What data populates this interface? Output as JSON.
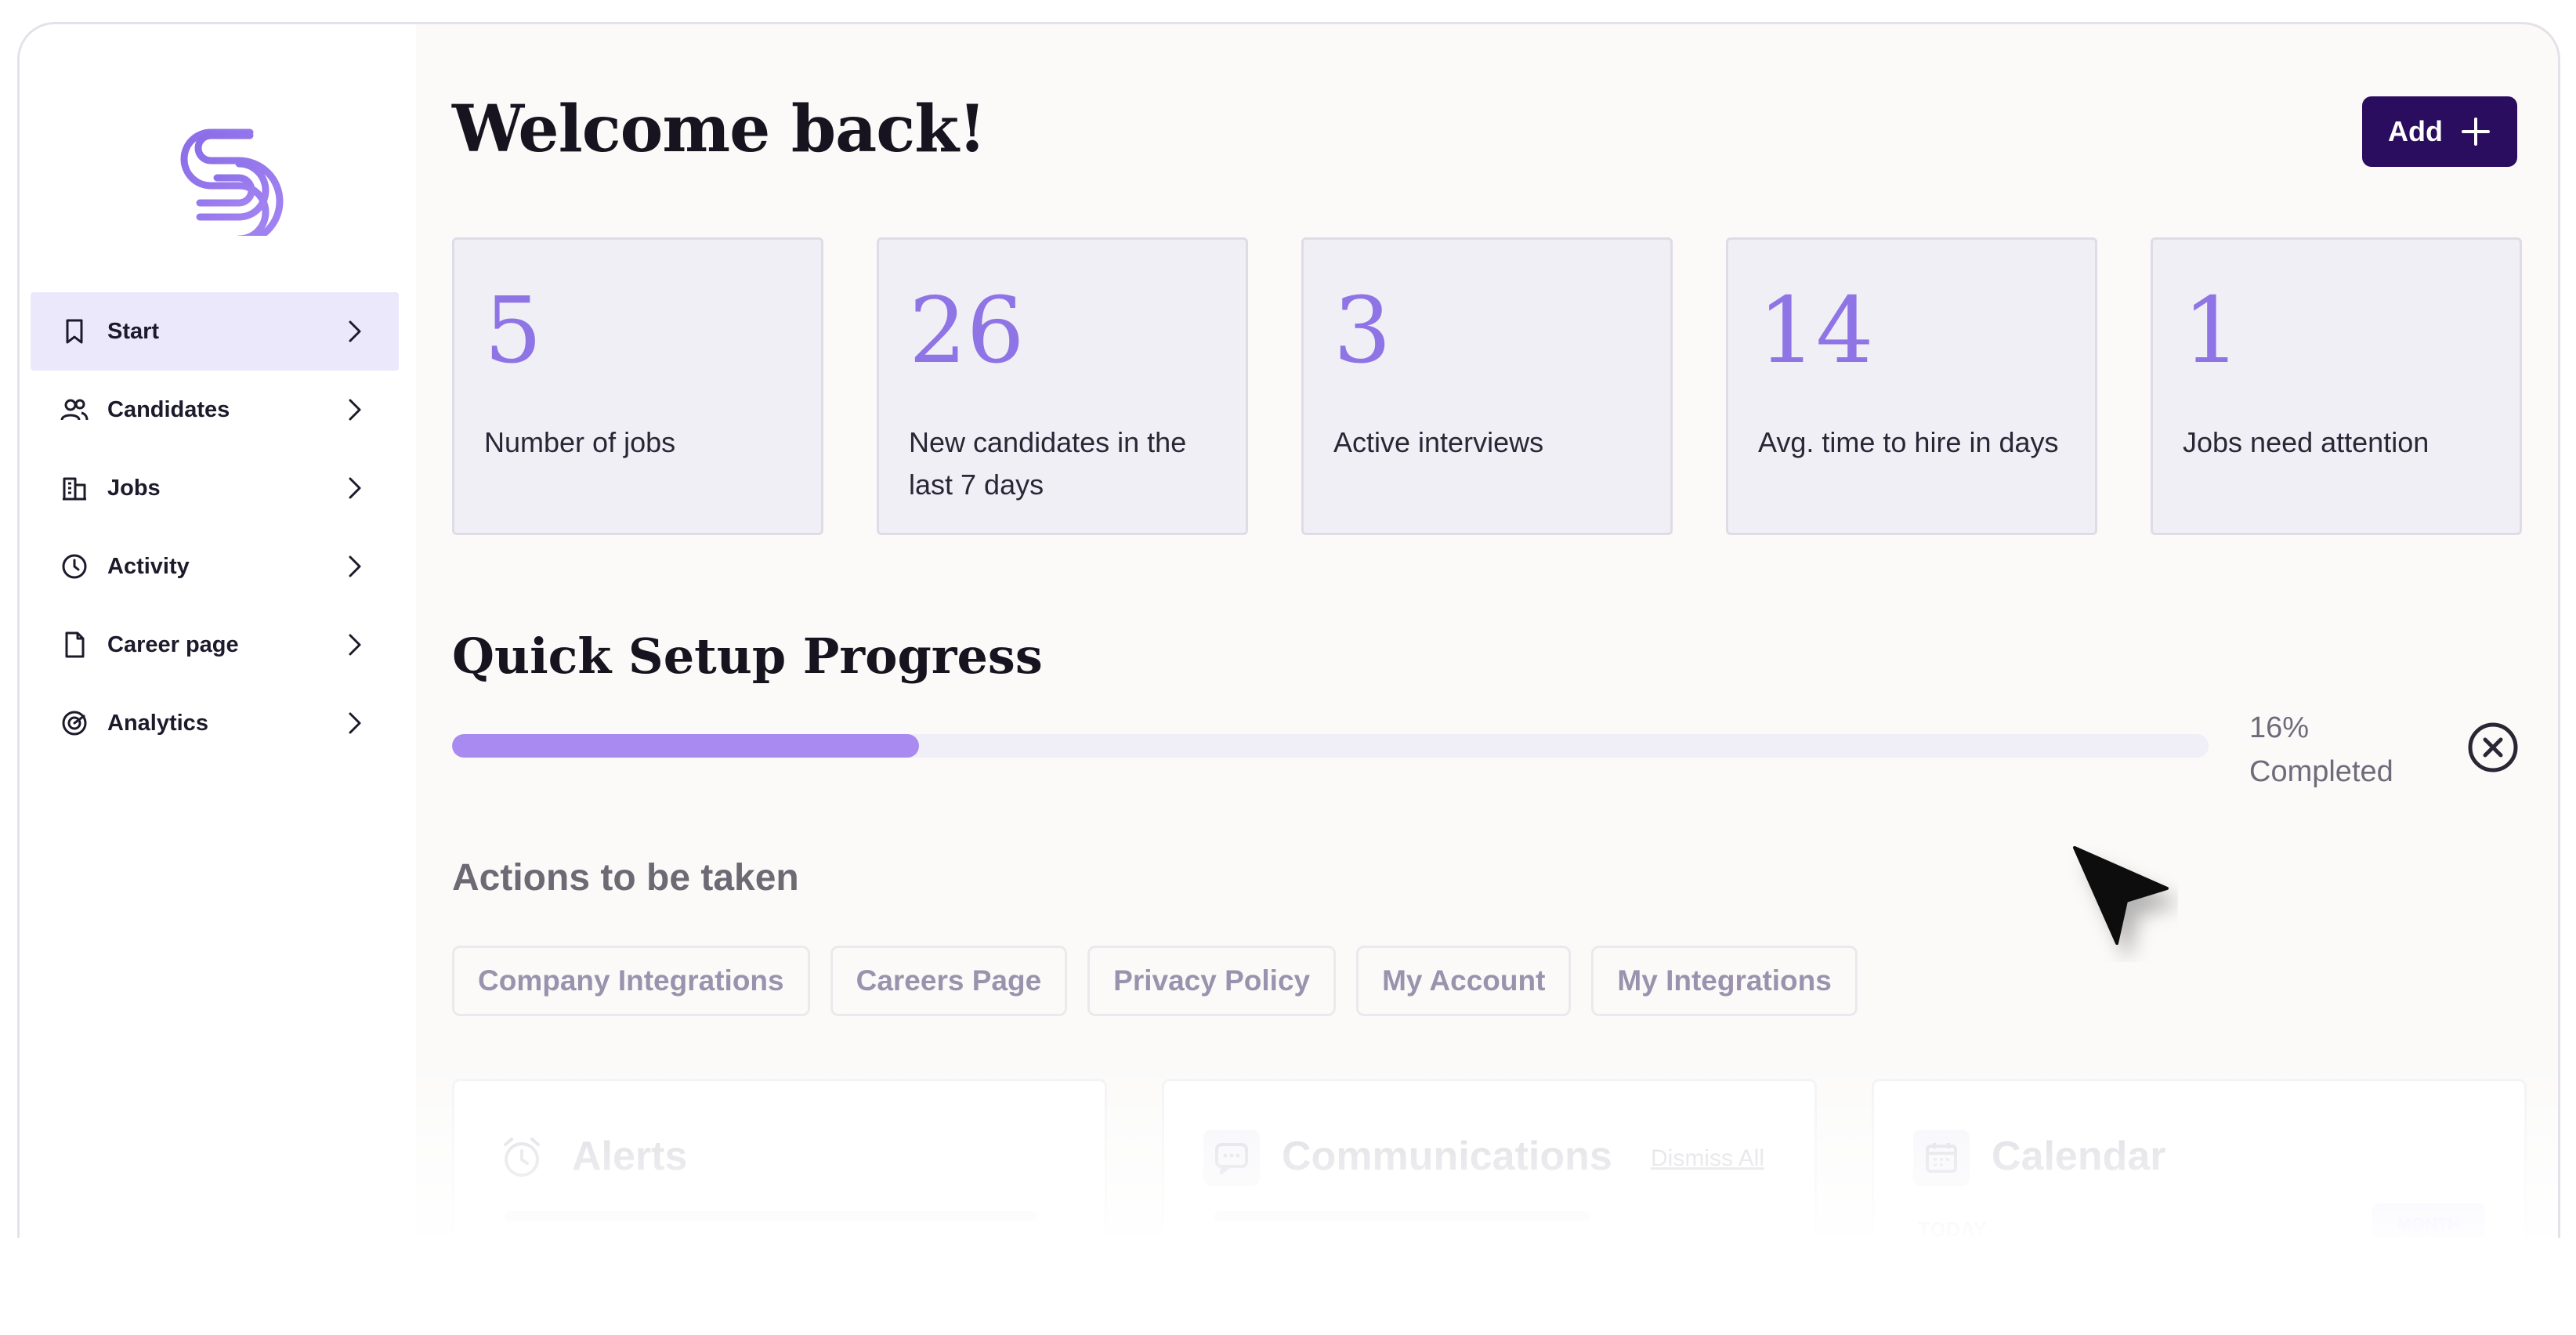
{
  "header": {
    "title": "Welcome back!",
    "add_label": "Add"
  },
  "sidebar": {
    "logo": "brand-logo",
    "items": [
      {
        "label": "Start",
        "icon": "bookmark-icon",
        "active": true
      },
      {
        "label": "Candidates",
        "icon": "users-icon",
        "active": false
      },
      {
        "label": "Jobs",
        "icon": "building-icon",
        "active": false
      },
      {
        "label": "Activity",
        "icon": "clock-icon",
        "active": false
      },
      {
        "label": "Career page",
        "icon": "document-icon",
        "active": false
      },
      {
        "label": "Analytics",
        "icon": "analytics-icon",
        "active": false
      }
    ]
  },
  "stats": [
    {
      "value": "5",
      "label": "Number of jobs"
    },
    {
      "value": "26",
      "label": "New candidates in the last 7 days"
    },
    {
      "value": "3",
      "label": "Active interviews"
    },
    {
      "value": "14",
      "label": "Avg. time to hire in days"
    },
    {
      "value": "1",
      "label": "Jobs need attention"
    }
  ],
  "setup": {
    "title": "Quick Setup Progress",
    "progress_fraction": 0.266,
    "percent_text": "16%",
    "completed_text": "Completed"
  },
  "actions": {
    "title": "Actions to be taken",
    "chips": [
      "Company Integrations",
      "Careers Page",
      "Privacy Policy",
      "My Account",
      "My Integrations"
    ]
  },
  "panels": {
    "alerts": {
      "title": "Alerts"
    },
    "communications": {
      "title": "Communications",
      "dismiss_label": "Dismiss All"
    },
    "calendar": {
      "title": "Calendar",
      "today_label": "TODAY",
      "month_label": "MONTH"
    }
  },
  "colors": {
    "accent": "#8f74e6",
    "primary_button": "#2a0d5e",
    "progress_fill": "#a98af0"
  }
}
